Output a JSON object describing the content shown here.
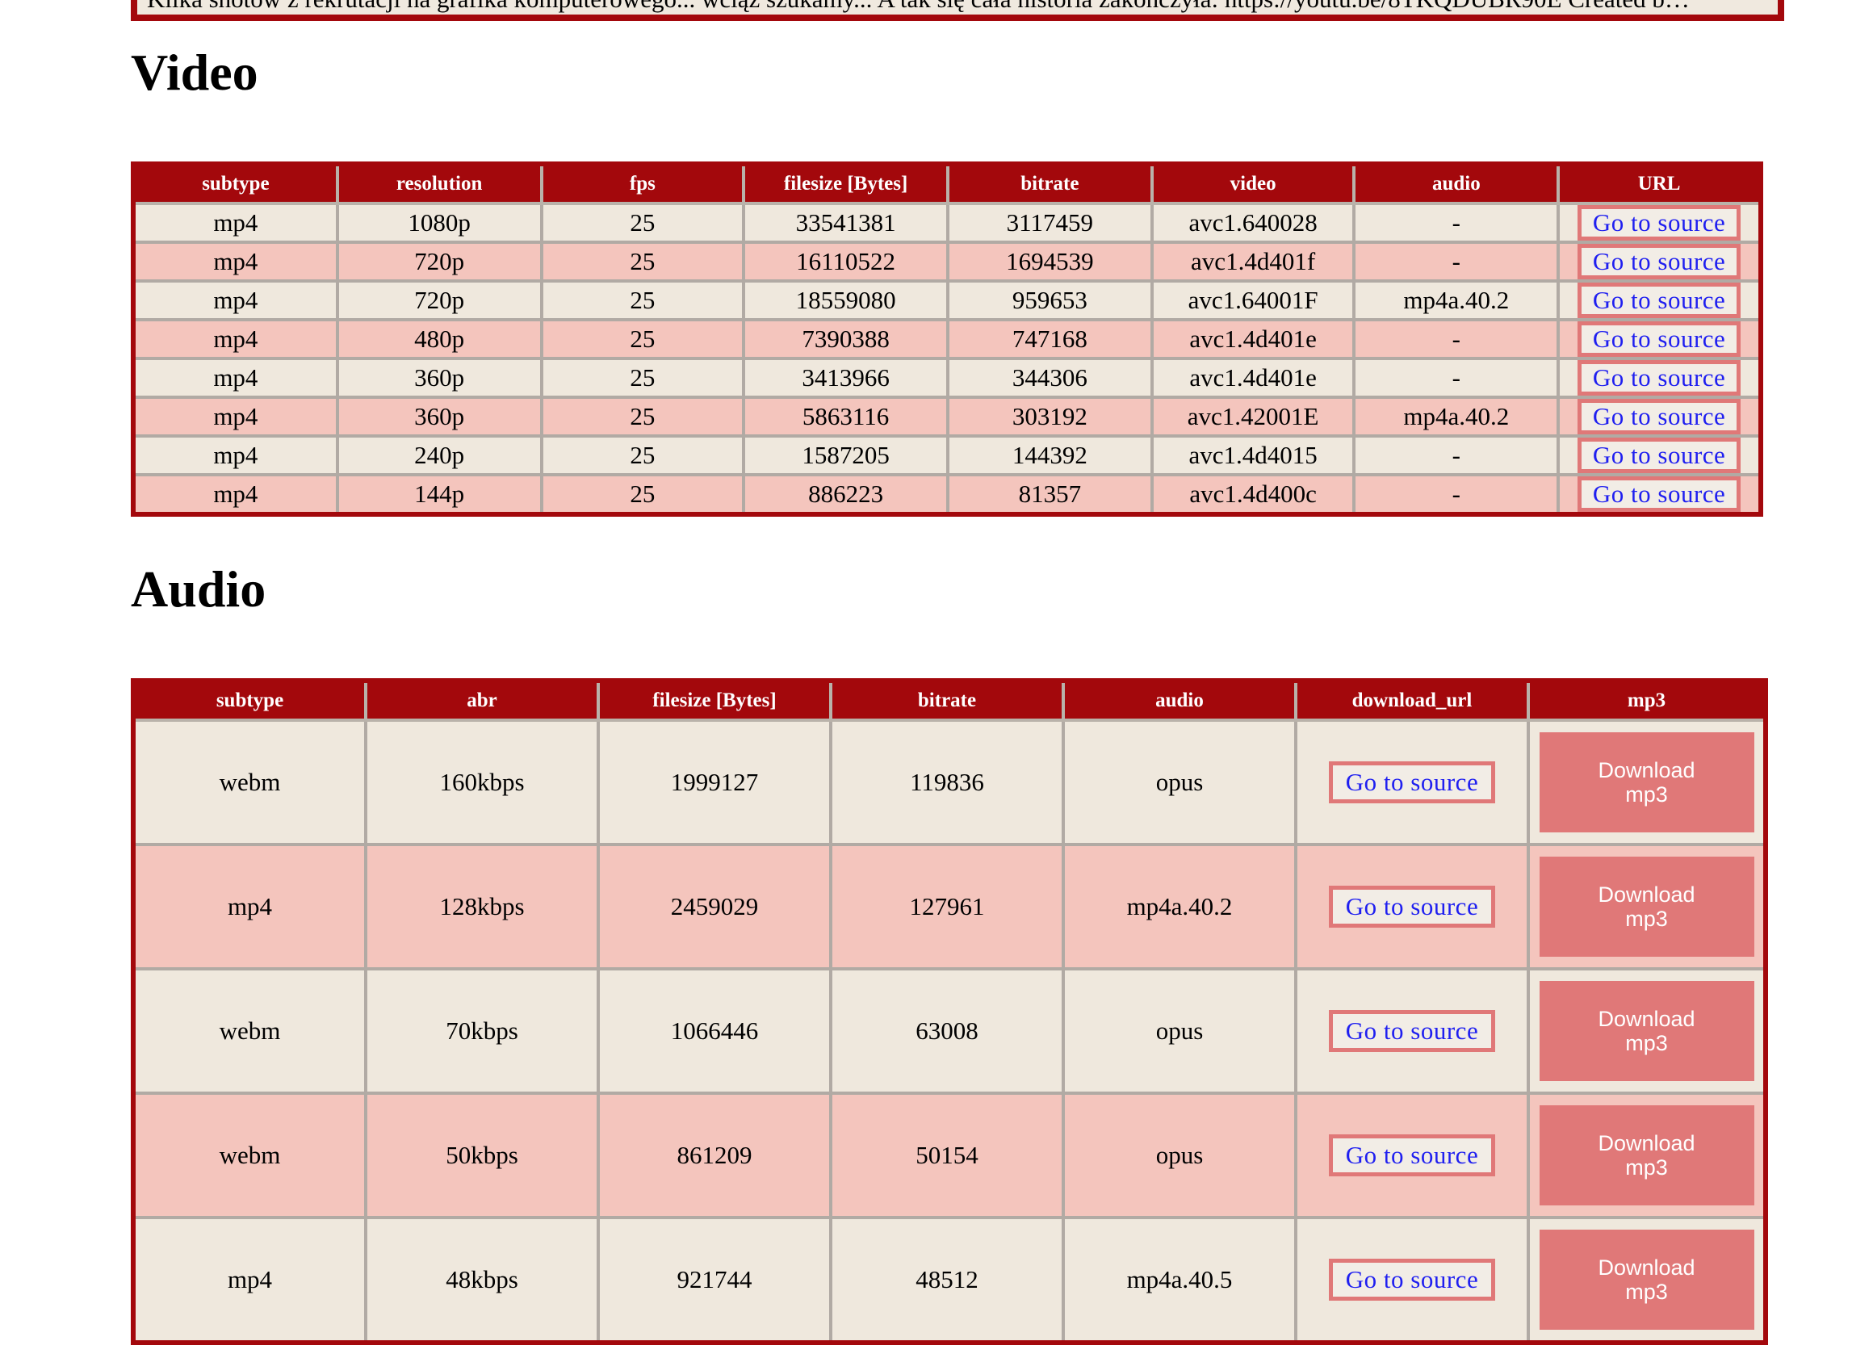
{
  "description": "Kilka shotów z rekrutacji na grafika komputerowego... wciąż szukamy... A tak się cała historia zakończyła: https://youtu.be/8TKQDUBR90E Created b…",
  "video": {
    "title": "Video",
    "headers": [
      "subtype",
      "resolution",
      "fps",
      "filesize [Bytes]",
      "bitrate",
      "video",
      "audio",
      "URL"
    ],
    "link_label": "Go to source",
    "rows": [
      {
        "subtype": "mp4",
        "resolution": "1080p",
        "fps": "25",
        "filesize": "33541381",
        "bitrate": "3117459",
        "video": "avc1.640028",
        "audio": "-"
      },
      {
        "subtype": "mp4",
        "resolution": "720p",
        "fps": "25",
        "filesize": "16110522",
        "bitrate": "1694539",
        "video": "avc1.4d401f",
        "audio": "-"
      },
      {
        "subtype": "mp4",
        "resolution": "720p",
        "fps": "25",
        "filesize": "18559080",
        "bitrate": "959653",
        "video": "avc1.64001F",
        "audio": "mp4a.40.2"
      },
      {
        "subtype": "mp4",
        "resolution": "480p",
        "fps": "25",
        "filesize": "7390388",
        "bitrate": "747168",
        "video": "avc1.4d401e",
        "audio": "-"
      },
      {
        "subtype": "mp4",
        "resolution": "360p",
        "fps": "25",
        "filesize": "3413966",
        "bitrate": "344306",
        "video": "avc1.4d401e",
        "audio": "-"
      },
      {
        "subtype": "mp4",
        "resolution": "360p",
        "fps": "25",
        "filesize": "5863116",
        "bitrate": "303192",
        "video": "avc1.42001E",
        "audio": "mp4a.40.2"
      },
      {
        "subtype": "mp4",
        "resolution": "240p",
        "fps": "25",
        "filesize": "1587205",
        "bitrate": "144392",
        "video": "avc1.4d4015",
        "audio": "-"
      },
      {
        "subtype": "mp4",
        "resolution": "144p",
        "fps": "25",
        "filesize": "886223",
        "bitrate": "81357",
        "video": "avc1.4d400c",
        "audio": "-"
      }
    ]
  },
  "audio": {
    "title": "Audio",
    "headers": [
      "subtype",
      "abr",
      "filesize [Bytes]",
      "bitrate",
      "audio",
      "download_url",
      "mp3"
    ],
    "link_label": "Go to source",
    "mp3_label": "Download mp3",
    "rows": [
      {
        "subtype": "webm",
        "abr": "160kbps",
        "filesize": "1999127",
        "bitrate": "119836",
        "audio": "opus"
      },
      {
        "subtype": "mp4",
        "abr": "128kbps",
        "filesize": "2459029",
        "bitrate": "127961",
        "audio": "mp4a.40.2"
      },
      {
        "subtype": "webm",
        "abr": "70kbps",
        "filesize": "1066446",
        "bitrate": "63008",
        "audio": "opus"
      },
      {
        "subtype": "webm",
        "abr": "50kbps",
        "filesize": "861209",
        "bitrate": "50154",
        "audio": "opus"
      },
      {
        "subtype": "mp4",
        "abr": "48kbps",
        "filesize": "921744",
        "bitrate": "48512",
        "audio": "mp4a.40.5"
      }
    ]
  },
  "colors": {
    "header_bg": "#a3080c",
    "row_odd": "#efe8dd",
    "row_even": "#f4c5bd",
    "button_accent": "#e07878",
    "link_text": "#1f1ff0"
  }
}
